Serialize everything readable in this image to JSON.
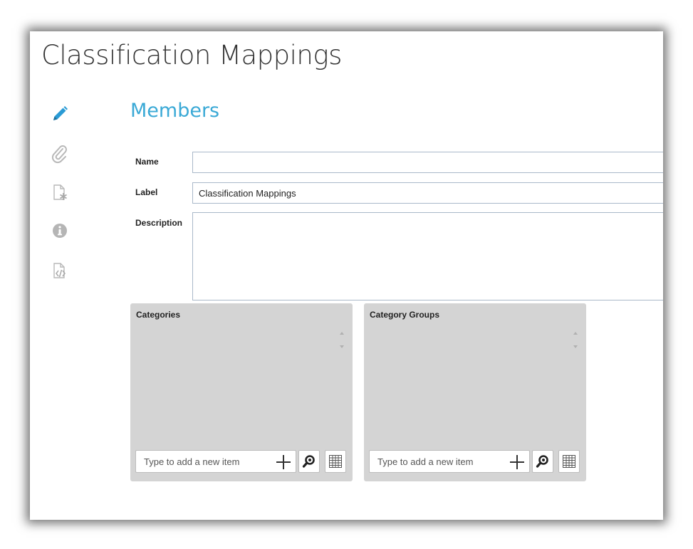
{
  "page": {
    "title": "Classification Mappings"
  },
  "sidebar": {
    "items": [
      {
        "icon": "pencil-icon",
        "color": "#2a9bd5",
        "active": true
      },
      {
        "icon": "paperclip-icon",
        "color": "#b5b5b5"
      },
      {
        "icon": "document-asterisk-icon",
        "color": "#b5b5b5"
      },
      {
        "icon": "info-icon",
        "color": "#b5b5b5"
      },
      {
        "icon": "document-code-icon",
        "color": "#b5b5b5"
      }
    ]
  },
  "section": {
    "title": "Members"
  },
  "form": {
    "name": {
      "label": "Name",
      "value": ""
    },
    "label": {
      "label": "Label",
      "value": "Classification Mappings"
    },
    "description": {
      "label": "Description",
      "value": ""
    }
  },
  "categories": {
    "title": "Categories",
    "add_placeholder": "Type to add a new item"
  },
  "category_groups": {
    "title": "Category Groups",
    "add_placeholder": "Type to add a new item"
  },
  "colors": {
    "accent": "#3aa9d6",
    "panel": "#d4d4d4",
    "input_border": "#a9b8c9"
  }
}
